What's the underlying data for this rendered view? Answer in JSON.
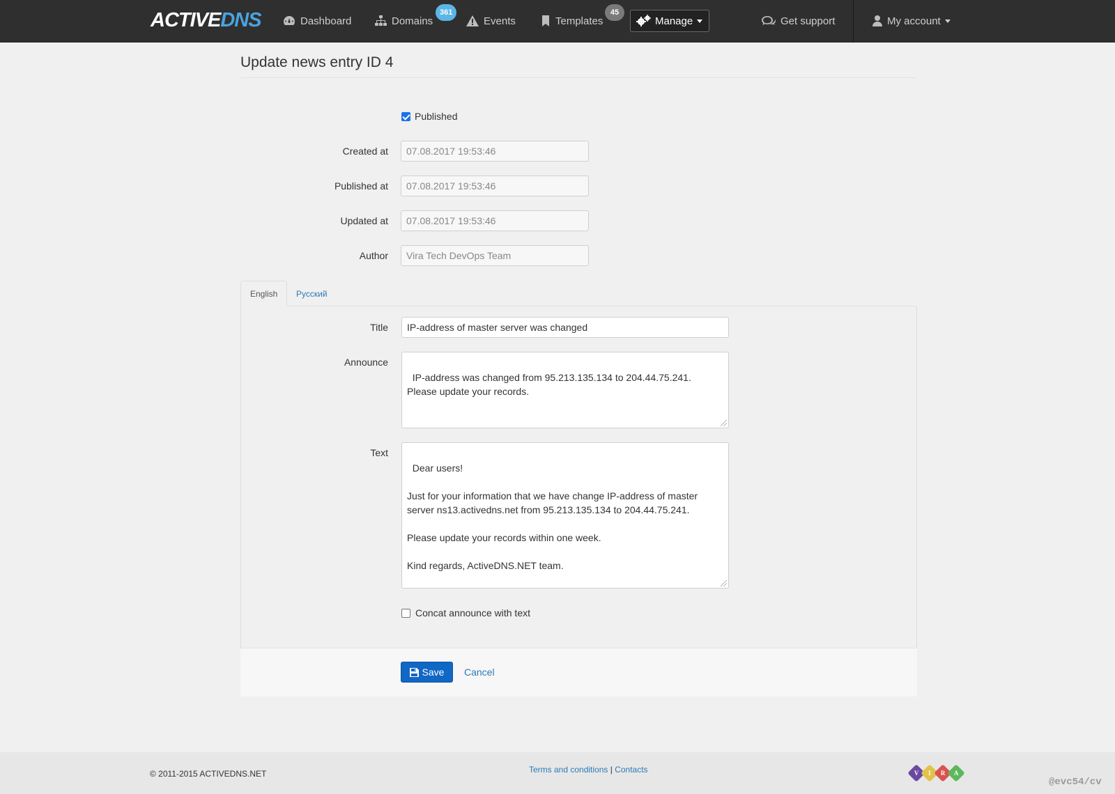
{
  "navbar": {
    "brand_part1": "ACTIVE",
    "brand_part2": "DNS",
    "items": [
      {
        "label": "Dashboard",
        "icon": "dashboard-icon"
      },
      {
        "label": "Domains",
        "icon": "sitemap-icon",
        "badge": "361"
      },
      {
        "label": "Events",
        "icon": "warning-icon"
      },
      {
        "label": "Templates",
        "icon": "bookmark-icon",
        "badge": "45"
      }
    ],
    "manage_label": "Manage",
    "support_label": "Get support",
    "account_label": "My account"
  },
  "page": {
    "title": "Update news entry ID 4"
  },
  "form": {
    "published_label": "Published",
    "published_checked": true,
    "created_at_label": "Created at",
    "created_at_placeholder": "07.08.2017 19:53:46",
    "published_at_label": "Published at",
    "published_at_placeholder": "07.08.2017 19:53:46",
    "updated_at_label": "Updated at",
    "updated_at_placeholder": "07.08.2017 19:53:46",
    "author_label": "Author",
    "author_placeholder": "Vira Tech DevOps Team"
  },
  "tabs": [
    {
      "label": "English",
      "active": true
    },
    {
      "label": "Русский",
      "active": false
    }
  ],
  "lang_form": {
    "title_label": "Title",
    "title_value": "IP-address of master server was changed",
    "announce_label": "Announce",
    "announce_value": "IP-address was changed from 95.213.135.134 to 204.44.75.241. Please update your records.",
    "text_label": "Text",
    "text_value": "Dear users!\n\nJust for your information that we have change IP-address of master server ns13.activedns.net from 95.213.135.134 to 204.44.75.241.\n\nPlease update your records within one week.\n\nKind regards, ActiveDNS.NET team.",
    "concat_label": "Concat announce with text",
    "concat_checked": false
  },
  "actions": {
    "save_label": "Save",
    "cancel_label": "Cancel"
  },
  "footer": {
    "copyright": "© 2011-2015 ACTIVEDNS.NET",
    "terms": "Terms and conditions",
    "separator": "|",
    "contacts": "Contacts",
    "vira_letters": [
      "V",
      "I",
      "R",
      "A"
    ],
    "vira_colors": [
      "#6a4aa0",
      "#e2c24a",
      "#d9534f",
      "#5cb85c"
    ],
    "watermark": "@evc54/cv"
  },
  "colors": {
    "navbar_bg": "#2f2f2f",
    "brand_accent": "#4aa3df",
    "primary_button": "#1067c4",
    "link": "#2a7ab8",
    "badge_blue": "#5bb5e6",
    "badge_gray": "#7a7a7a"
  }
}
